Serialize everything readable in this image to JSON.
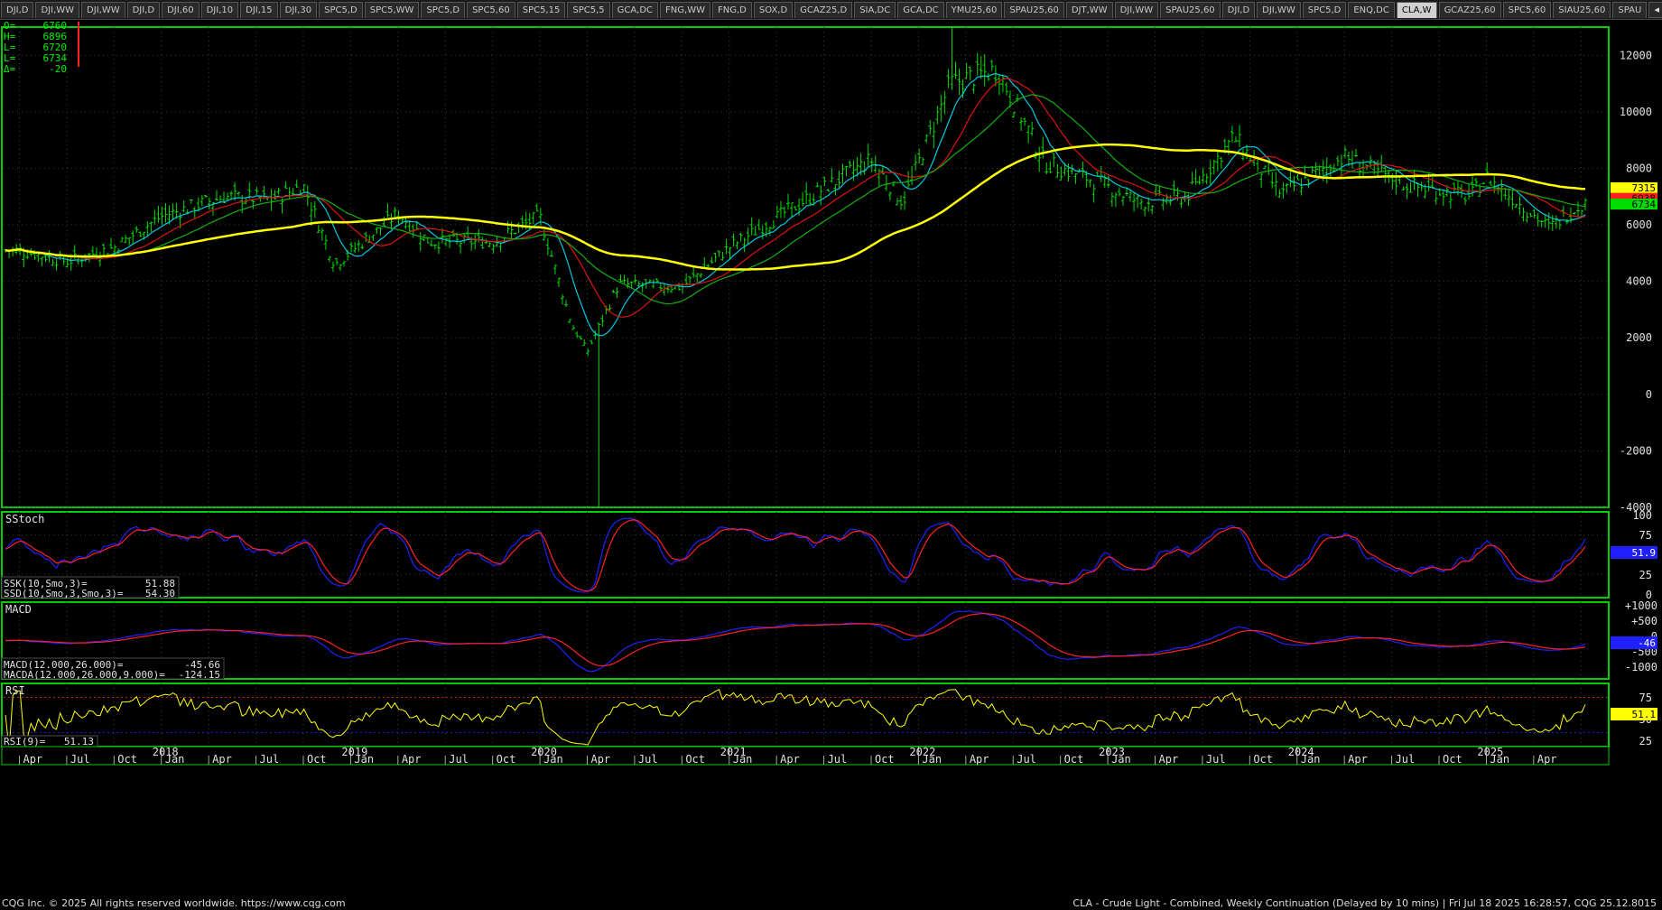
{
  "tabs": [
    {
      "label": "DJI,D"
    },
    {
      "label": "DJI,WW"
    },
    {
      "label": "DJI,WW"
    },
    {
      "label": "DJI,D"
    },
    {
      "label": "DJI,60"
    },
    {
      "label": "DJI,10"
    },
    {
      "label": "DJI,15"
    },
    {
      "label": "DJI,30"
    },
    {
      "label": "SPC5,D"
    },
    {
      "label": "SPC5,WW"
    },
    {
      "label": "SPC5,D"
    },
    {
      "label": "SPC5,60"
    },
    {
      "label": "SPC5,15"
    },
    {
      "label": "SPC5,5"
    },
    {
      "label": "GCA,DC"
    },
    {
      "label": "FNG,WW"
    },
    {
      "label": "FNG,D"
    },
    {
      "label": "SOX,D"
    },
    {
      "label": "GCAZ25,D"
    },
    {
      "label": "SIA,DC"
    },
    {
      "label": "GCA,DC"
    },
    {
      "label": "YMU25,60"
    },
    {
      "label": "SPAU25,60"
    },
    {
      "label": "DJT,WW"
    },
    {
      "label": "DJI,WW"
    },
    {
      "label": "SPAU25,60"
    },
    {
      "label": "DJI,D"
    },
    {
      "label": "DJI,WW"
    },
    {
      "label": "SPC5,D"
    },
    {
      "label": "ENQ,DC"
    },
    {
      "label": "CLA,W",
      "active": true
    },
    {
      "label": "GCAZ25,60"
    },
    {
      "label": "SPC5,60"
    },
    {
      "label": "SIAU25,60"
    },
    {
      "label": "SPAU"
    }
  ],
  "tab_controls": {
    "prev": "◂",
    "next": "▸",
    "add": "+"
  },
  "ohlc": {
    "o_label": "O=",
    "o_value": "6760",
    "h_label": "H=",
    "h_value": "6896",
    "l_label": "L=",
    "l_value": "6720",
    "c_label": "L=",
    "c_value": "6734",
    "d_label": "Δ=",
    "d_value": "-20"
  },
  "price_axis": {
    "ticks": [
      "12000",
      "10000",
      "8000",
      "6000",
      "4000",
      "2000",
      "0",
      "-2000",
      "-4000"
    ]
  },
  "price_tags": [
    {
      "value": "7315",
      "bg": "#ffff00",
      "fg": "#000000"
    },
    {
      "value": "6938",
      "bg": "#ff2020",
      "fg": "#000000"
    },
    {
      "value": "6734",
      "bg": "#00dd00",
      "fg": "#000000"
    }
  ],
  "sstoch": {
    "title": "SStoch",
    "ssk_label": "SSK(10,Smo,3)=",
    "ssk_value": "51.88",
    "ssd_label": "SSD(10,Smo,3,Smo,3)=",
    "ssd_value": "54.30",
    "axis": [
      "100",
      "75",
      "50",
      "25",
      "0"
    ],
    "tag": "51.9"
  },
  "macd": {
    "title": "MACD",
    "macd_label": "MACD(12.000,26.000)=",
    "macd_value": "-45.66",
    "macda_label": "MACDA(12.000,26.000,9.000)=",
    "macda_value": "-124.15",
    "axis": [
      "+1000",
      "+500",
      "0",
      "-500",
      "-1000"
    ],
    "tag": "-46"
  },
  "rsi": {
    "title": "RSI",
    "rsi_label": "RSI(9)=",
    "rsi_value": "51.13",
    "axis": [
      "75",
      "50",
      "25"
    ],
    "tag": "51.1"
  },
  "time_axis": {
    "months": [
      "Apr",
      "Jul",
      "Oct",
      "Jan",
      "Apr",
      "Jul",
      "Oct",
      "Jan",
      "Apr",
      "Jul",
      "Oct",
      "Jan",
      "Apr",
      "Jul",
      "Oct",
      "Jan",
      "Apr",
      "Jul",
      "Oct",
      "Jan",
      "Apr",
      "Jul",
      "Oct",
      "Jan",
      "Apr",
      "Jul",
      "Oct",
      "Jan",
      "Apr",
      "Jul",
      "Oct",
      "Jan",
      "Apr"
    ],
    "years": [
      "2018",
      "2019",
      "2020",
      "2021",
      "2022",
      "2023",
      "2024",
      "2025"
    ]
  },
  "footer": {
    "copyright": "CQG Inc. © 2025 All rights reserved worldwide. https://www.cqg.com",
    "status": "CLA - Crude Light - Combined, Weekly Continuation (Delayed by 10 mins) | Fri Jul 18 2025 16:28:57, CQG 25.12.8015"
  },
  "colors": {
    "bars": "#00dd00",
    "ma_cyan": "#00c8e0",
    "ma_red": "#e01010",
    "ma_green": "#10b010",
    "ma_yellow": "#ffff00",
    "stoch_k": "#2020ff",
    "stoch_d": "#ff2020",
    "rsi": "#ffff00",
    "frame": "#00cc00",
    "grid": "#3a3a3a"
  },
  "chart_data": {
    "type": "candlestick-weekly",
    "symbol": "CLA",
    "interval": "W",
    "price_unit_note": "cents",
    "ylim": [
      -4000,
      13000
    ],
    "anchors": [
      {
        "date": "2017-04",
        "price": 5100
      },
      {
        "date": "2017-07",
        "price": 4700
      },
      {
        "date": "2017-10",
        "price": 5200
      },
      {
        "date": "2018-01",
        "price": 6300
      },
      {
        "date": "2018-05",
        "price": 7000
      },
      {
        "date": "2018-08",
        "price": 6900
      },
      {
        "date": "2018-10",
        "price": 7400
      },
      {
        "date": "2018-12",
        "price": 4600
      },
      {
        "date": "2019-04",
        "price": 6400
      },
      {
        "date": "2019-06",
        "price": 5400
      },
      {
        "date": "2019-10",
        "price": 5400
      },
      {
        "date": "2020-01",
        "price": 6300
      },
      {
        "date": "2020-03",
        "price": 2500
      },
      {
        "date": "2020-04",
        "price": 1500
      },
      {
        "date": "2020-06",
        "price": 3900
      },
      {
        "date": "2020-10",
        "price": 3800
      },
      {
        "date": "2021-01",
        "price": 5200
      },
      {
        "date": "2021-07",
        "price": 7300
      },
      {
        "date": "2021-10",
        "price": 8300
      },
      {
        "date": "2021-12",
        "price": 6800
      },
      {
        "date": "2022-03",
        "price": 11000
      },
      {
        "date": "2022-06",
        "price": 11500
      },
      {
        "date": "2022-09",
        "price": 8200
      },
      {
        "date": "2022-12",
        "price": 7600
      },
      {
        "date": "2023-03",
        "price": 6800
      },
      {
        "date": "2023-06",
        "price": 7000
      },
      {
        "date": "2023-09",
        "price": 9100
      },
      {
        "date": "2023-12",
        "price": 7100
      },
      {
        "date": "2024-04",
        "price": 8400
      },
      {
        "date": "2024-08",
        "price": 7400
      },
      {
        "date": "2024-12",
        "price": 7000
      },
      {
        "date": "2025-01",
        "price": 7700
      },
      {
        "date": "2025-05",
        "price": 5900
      },
      {
        "date": "2025-07",
        "price": 6734
      }
    ],
    "extremes": {
      "high_2022": 13000,
      "low_2020_04": -4000
    }
  }
}
